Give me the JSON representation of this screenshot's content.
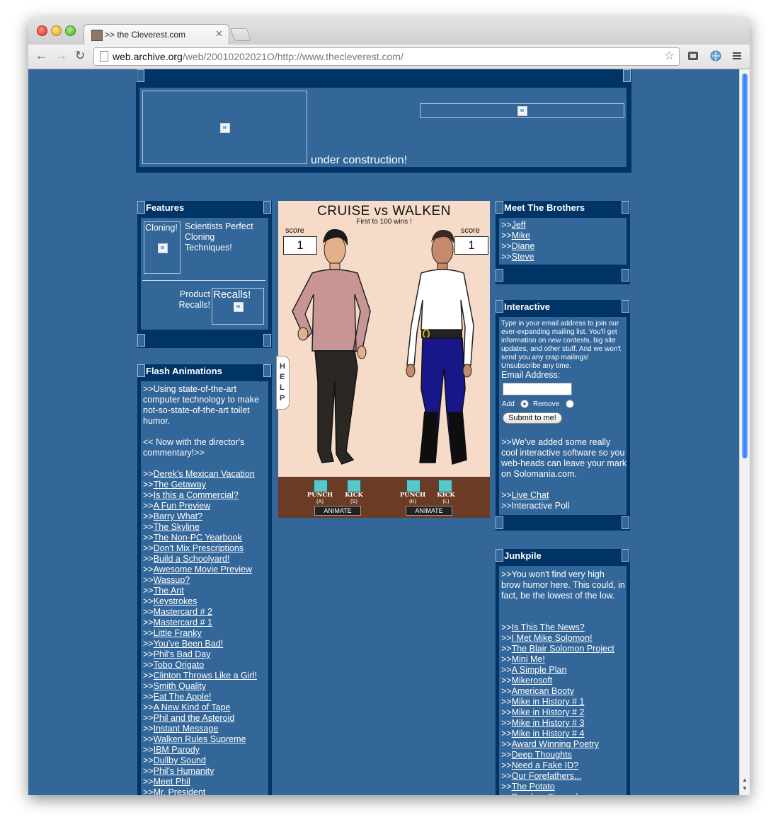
{
  "browser": {
    "tab_title": ">> the Cleverest.com",
    "url_host": "web.archive.org",
    "url_path": "/web/20010202021O/http://www.thecleverest.com/"
  },
  "header": {
    "under_construction": "under construction!"
  },
  "features": {
    "title": "Features",
    "cloning_label": "Cloning!",
    "cloning_text": "Scientists Perfect Cloning Techniques!",
    "recalls_text": "Product Recalls!",
    "recalls_label": "Recalls!"
  },
  "flash": {
    "title": "Flash Animations",
    "intro": ">>Using state-of-the-art computer technology to make not-so-state-of-the-art toilet humor.",
    "commentary": "<< Now with the director's commentary!>>",
    "prefix": ">>",
    "links": [
      "Derek's Mexican Vacation",
      "The Getaway",
      "Is this a Commercial?",
      "A Fun Preview",
      "Barry What?",
      "The Skyline",
      "The Non-PC Yearbook",
      "Don't Mix Prescriptions",
      "Build a Schoolyard!",
      "Awesome Movie Preview",
      "Wassup?",
      "The Ant",
      "Keystrokes",
      "Mastercard # 2",
      "Mastercard # 1",
      "Little Franky",
      "You've Been Bad!",
      "Phil's Bad Day",
      "Tobo Origato",
      "Clinton Throws Like a Girl!",
      "Smith Quality",
      "Eat The Apple!",
      "A New Kind of Tape",
      "Phil and the Asteroid",
      "Instant Message",
      "Walken Rules Supreme",
      "IBM Parody",
      "Dullby Sound",
      "Phil's Humanity",
      "Meet Phil",
      "Mr. President"
    ]
  },
  "game": {
    "title": "CRUISE vs WALKEN",
    "subtitle": "First  to 100 wins !",
    "score_label": "score",
    "score_left": "1",
    "score_right": "1",
    "help": [
      "H",
      "E",
      "L",
      "P"
    ],
    "punch": "PUNCH",
    "kick": "KICK",
    "key_a": "(A)",
    "key_s": "(S)",
    "key_k": "(K)",
    "key_l": "(L)",
    "animate": "ANIMATE"
  },
  "brothers": {
    "title": "Meet The Brothers",
    "prefix": ">>",
    "links": [
      "Jeff",
      "Mike",
      "Diane",
      "Steve"
    ]
  },
  "interactive": {
    "title": "Interactive",
    "intro": "Type in your email address to join our ever-expanding mailing list. You'll get information on new contests, big site updates, and other stuff. And we won't send you any crap mailings! Unsubscribe any time.",
    "email_label": "Email Address:",
    "email_value": "",
    "add": "Add",
    "remove": "Remove",
    "submit": "Submit to me!",
    "software": ">>We've added some really cool interactive software so you web-heads can leave your mark on Solomania.com.",
    "live_chat": "Live Chat",
    "poll": ">>Interactive Poll",
    "prefix": ">>"
  },
  "junkpile": {
    "title": "Junkpile",
    "intro": ">>You won't find very high brow humor here. This could, in fact, be the lowest of the low.",
    "prefix": ">>",
    "links": [
      "Is This The News?",
      "I Met Mike Solomon!",
      "The Blair Solomon Project ",
      "Mini Me! ",
      "A Simple Plan ",
      "Mikerosoft",
      "American Booty",
      "Mike in History # 1",
      "Mike in History # 2",
      "Mike in History # 3",
      "Mike in History # 4",
      "Award Winning Poetry",
      "Deep Thoughts",
      "Need a Fake ID?",
      "Our Forefathers...",
      "The Potato",
      "Drunken Sing-a-long"
    ]
  },
  "colors": {
    "page_bg": "#336699",
    "panel_dark": "#003366"
  }
}
